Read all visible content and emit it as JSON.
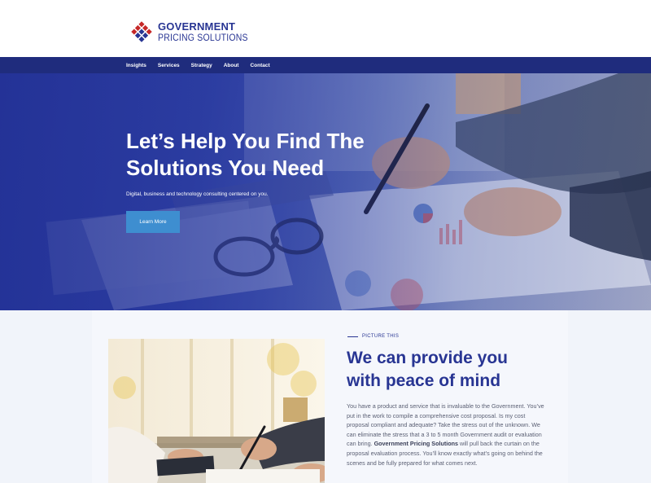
{
  "logo": {
    "line1": "GOVERNMENT",
    "line2": "PRICING SOLUTIONS"
  },
  "nav": {
    "items": [
      "Insights",
      "Services",
      "Strategy",
      "About",
      "Contact"
    ]
  },
  "hero": {
    "title": "Let’s Help You Find The Solutions You Need",
    "subtitle": "Digital, business and technology consulting centered on you.",
    "cta_label": "Learn More"
  },
  "section": {
    "eyebrow": "PICTURE THIS",
    "title": "We can provide you with peace of mind",
    "body_part1": "You have a product and service that is invaluable to the Government. You’ve put in the work to compile a comprehensive cost proposal. Is my cost proposal compliant and adequate? Take the stress out of the unknown. We can eliminate the stress that a 3 to 5 month Government audit or evaluation can bring.",
    "body_bold": "Government Pricing Solutions",
    "body_part2": "will pull back the curtain on the proposal evaluation process. You’ll know exactly what’s going on behind the scenes and be fully prepared for what comes next."
  },
  "colors": {
    "brand_blue": "#283593",
    "nav_bg": "#1f2c7d",
    "cta_blue": "#3e8ed0",
    "logo_red": "#c62828"
  },
  "icons": {
    "logo_mark": "diamond-grid-logo-icon"
  }
}
